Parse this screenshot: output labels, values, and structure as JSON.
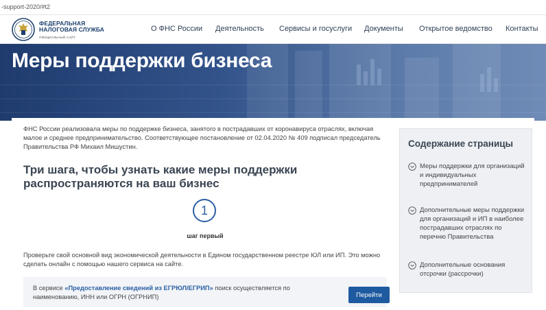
{
  "url_text": "-support-2020/#t2",
  "header": {
    "logo_line1": "ФЕДЕРАЛЬНАЯ",
    "logo_line2": "НАЛОГОВАЯ СЛУЖБА",
    "logo_line3": "ОФИЦИАЛЬНЫЙ САЙТ",
    "nav": [
      "О ФНС России",
      "Деятельность",
      "Сервисы и госуслуги",
      "Документы",
      "Открытое ведомство",
      "Контакты"
    ]
  },
  "hero": {
    "title": "Меры поддержки бизнеса"
  },
  "main": {
    "intro": "ФНС России реализовала меры по поддержке бизнеса, занятого в пострадавших от коронавируса отраслях, включая малое и среднее предпринимательство. Соответствующее постановление от 02.04.2020 № 409 подписал председатель Правительства РФ Михаил Мишустин.",
    "heading": "Три шага, чтобы узнать какие меры поддержки распространяются на ваш бизнес",
    "step_number": "1",
    "step_label": "шаг первый",
    "step_text": "Проверьте свой основной вид экономической деятельности в Едином государственном реестре ЮЛ или ИП. Это можно сделать онлайн с помощью нашего сервиса на сайте.",
    "service": {
      "prefix": "В сервисе ",
      "link": "«Предоставление сведений из ЕГРЮЛ/ЕГРИП»",
      "suffix": " поиск осуществляется по наименованию, ИНН или ОГРН (ОГРНИП)",
      "button": "Перейти"
    }
  },
  "toc": {
    "title": "Содержание страницы",
    "items": [
      "Меры поддержки для организаций и индивидуальных предпринимателей",
      "Дополнительные меры поддержки для организаций и ИП в наиболее пострадавших отраслях по перечню Правительства",
      "Дополнительные основания отсрочки (рассрочки)"
    ]
  },
  "colors": {
    "brand_blue": "#1e5aa0",
    "heading": "#3a4552",
    "hero": "#32538a"
  }
}
